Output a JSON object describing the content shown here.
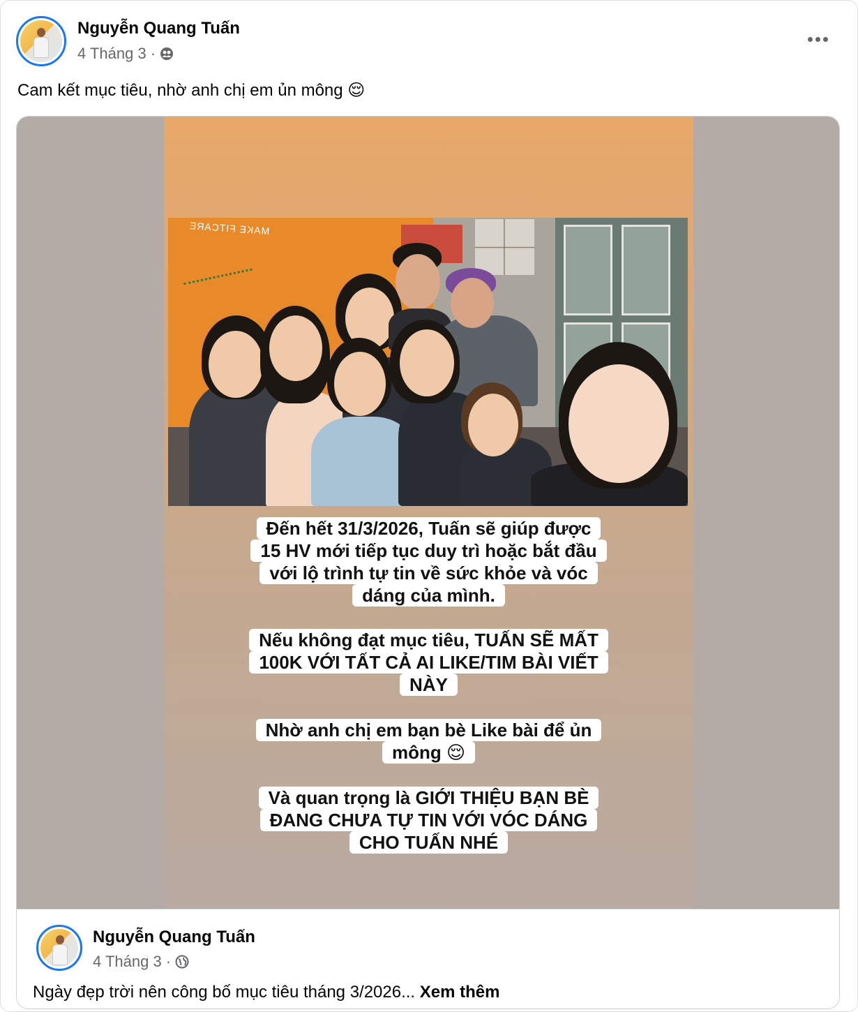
{
  "post": {
    "author": "Nguyễn Quang Tuấn",
    "date": "4 Tháng 3",
    "separator": "·",
    "audience_icon": "friends-icon",
    "caption": "Cam kết mục tiêu, nhờ anh chị em ủn mông 😌",
    "more_icon": "more-horizontal-icon"
  },
  "story": {
    "banner_text": "MAKE FITCARE",
    "blocks": [
      {
        "lines": [
          "Đến hết 31/3/2026, Tuấn sẽ giúp được",
          "15 HV mới tiếp tục duy trì hoặc bắt đầu",
          "với lộ trình tự tin về sức khỏe và vóc",
          "dáng của mình."
        ]
      },
      {
        "lines": [
          "Nếu không đạt mục tiêu, TUẤN SẼ MẤT",
          "100K VỚI TẤT CẢ AI LIKE/TIM BÀI VIẾT",
          "NÀY"
        ]
      },
      {
        "lines": [
          "Nhờ anh chị em bạn bè Like bài để ủn",
          "mông 😌"
        ]
      },
      {
        "lines": [
          "Và quan trọng là GIỚI THIỆU BẠN BÈ",
          "ĐANG CHƯA TỰ TIN VỚI VÓC DÁNG",
          "CHO TUẤN NHÉ"
        ]
      }
    ]
  },
  "shared": {
    "author": "Nguyễn Quang Tuấn",
    "date": "4 Tháng 3",
    "separator": "·",
    "audience_icon": "globe-icon",
    "text": "Ngày đẹp trời nên công bố mục tiêu tháng 3/2026...",
    "see_more": "Xem thêm"
  },
  "colors": {
    "accent": "#1877f2",
    "secondary_text": "#65676b",
    "story_top": "#e8a868",
    "story_bottom": "#b9aaa2",
    "media_background": "#b5aba6"
  }
}
